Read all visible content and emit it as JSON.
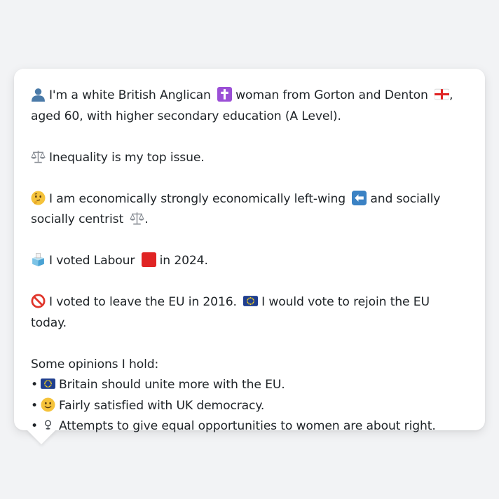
{
  "profile": {
    "intro_a": "I'm a white British Anglican",
    "intro_b": "woman from Gorton and Denton",
    "intro_c": ", aged 60, with higher secondary education (A Level).",
    "top_issue": "Inequality is my top issue.",
    "economic_a": "I am economically strongly economically left-wing",
    "economic_b": "and socially socially centrist",
    "economic_c": ".",
    "vote_a": "I voted Labour",
    "vote_b": "in 2024.",
    "eu_a": "I voted to leave the EU in 2016.",
    "eu_b": "I would vote to rejoin the EU today.",
    "opinions_heading": "Some opinions I hold:",
    "opinions": [
      "Britain should unite more with the EU.",
      "Fairly satisfied with UK democracy.",
      "Attempts to give equal opportunities to women are about right."
    ],
    "bullet": "•"
  },
  "icons": {
    "person": "bust-silhouette-icon",
    "religion": "latin-cross-icon",
    "flag": "england-flag-icon",
    "scales": "balance-scale-icon",
    "thinking": "thinking-face-icon",
    "left_arrow": "left-arrow-icon",
    "ballot": "ballot-box-icon",
    "labour": "red-square-icon",
    "no": "prohibited-icon",
    "eu": "eu-flag-icon",
    "smile": "slightly-smiling-face-icon",
    "female": "female-sign-icon"
  },
  "colors": {
    "background": "#f2f3f5",
    "card": "#ffffff",
    "text": "#1f2428",
    "labour_red": "#e02424",
    "eu_blue": "#1f3e8f",
    "cross_purple": "#9b4fd6",
    "arrow_blue": "#3b82c4"
  }
}
